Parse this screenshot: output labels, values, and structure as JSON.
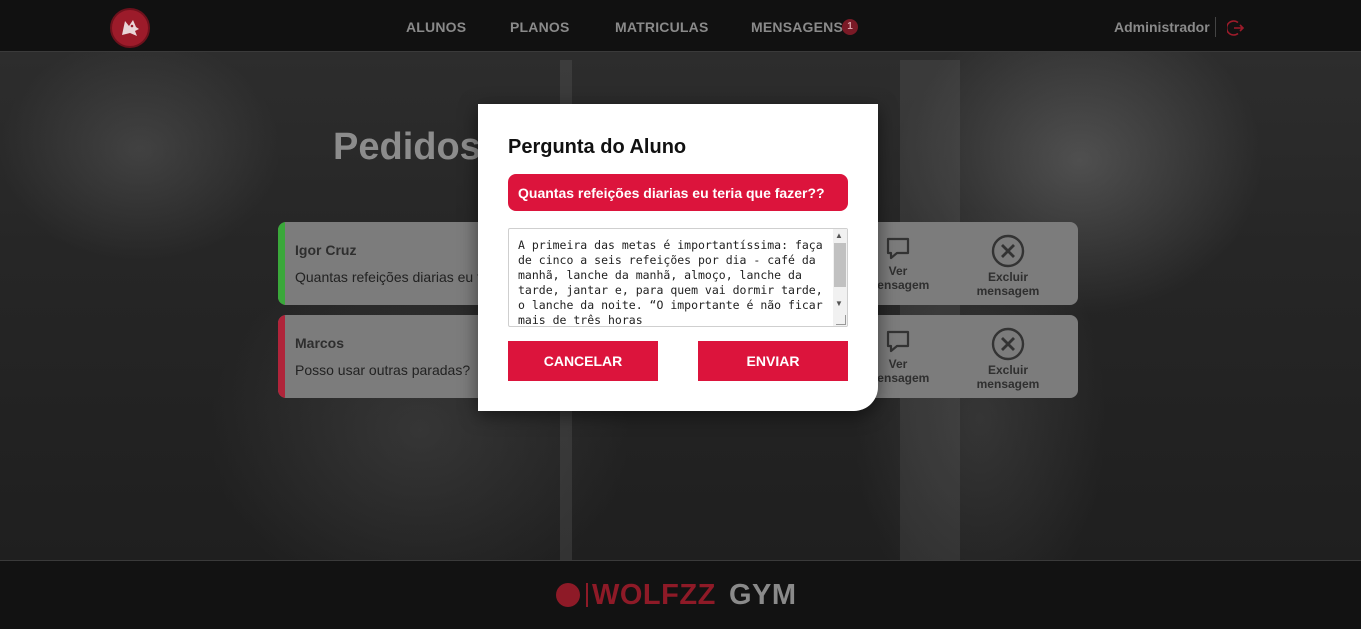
{
  "navbar": {
    "links": [
      "ALUNOS",
      "PLANOS",
      "MATRICULAS",
      "MENSAGENS"
    ],
    "messages_badge": "1",
    "user_label": "Administrador",
    "logo_icon": "wolf-icon",
    "logout_icon": "logout-icon"
  },
  "page": {
    "title": "Pedidos"
  },
  "messages": [
    {
      "name": "Igor Cruz",
      "text": "Quantas refeições diarias eu t",
      "status_color": "#3aa83a",
      "view_label": "Ver\nmensagem",
      "delete_label": "Excluir\nmensagem"
    },
    {
      "name": "Marcos",
      "text": "Posso usar outras paradas?",
      "status_color": "#b0243a",
      "view_label": "Ver\nmensagem",
      "delete_label": "Excluir\nmensagem"
    }
  ],
  "modal": {
    "title": "Pergunta do Aluno",
    "question": "Quantas refeições diarias eu teria que fazer??",
    "answer": "A primeira das metas é importantíssima: faça de cinco a seis refeições por dia - café da manhã, lanche da manhã, almoço, lanche da tarde, jantar e, para quem vai dormir tarde, o lanche da noite. “O importante é não ficar mais de três horas",
    "cancel_label": "CANCELAR",
    "send_label": "ENVIAR"
  },
  "footer": {
    "brand_primary": "WOLFZZ",
    "brand_secondary": "GYM"
  },
  "colors": {
    "accent": "#dc143c",
    "navbar_bg": "#111111"
  }
}
